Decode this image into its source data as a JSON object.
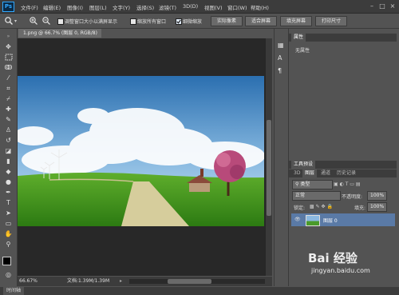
{
  "app": {
    "logo": "Ps"
  },
  "menu": [
    "文件(F)",
    "编辑(E)",
    "图像(I)",
    "图层(L)",
    "文字(Y)",
    "选择(S)",
    "滤镜(T)",
    "3D(D)",
    "视图(V)",
    "窗口(W)",
    "帮助(H)"
  ],
  "window_controls": {
    "minimize": "–",
    "maximize": "□",
    "close": "×"
  },
  "options": {
    "resize_windows_label": "调整窗口大小以满屏显示",
    "resize_windows_checked": false,
    "zoom_all_label": "缩放所有窗口",
    "zoom_all_checked": false,
    "scrubby_label": "细微缩放",
    "scrubby_checked": true,
    "actual_pixels": "实际像素",
    "fit_screen": "适合屏幕",
    "fill_screen": "填充屏幕",
    "print_size": "打印尺寸"
  },
  "document": {
    "tab_title": "1.png @ 66.7% (图层 0, RGB/8)",
    "tab_close": "×"
  },
  "statusbar": {
    "zoom": "66.67%",
    "doc_info": "文档:1.39M/1.39M"
  },
  "bottom": {
    "tab": "时间轴"
  },
  "properties": {
    "title": "属性",
    "content": "无属性"
  },
  "tool_presets": {
    "title": "工具预设"
  },
  "layers": {
    "tabs": [
      "3D",
      "图层",
      "通道",
      "历史记录"
    ],
    "active_tab": "图层",
    "kind_filter": "类型",
    "blend_mode": "正常",
    "opacity_label": "不透明度:",
    "opacity_value": "100%",
    "lock_label": "锁定:",
    "fill_label": "填充:",
    "fill_value": "100%",
    "layer_list": [
      {
        "name": "图层 0",
        "visible": true
      }
    ]
  },
  "watermark": {
    "text": "Bai 经验",
    "url": "jingyan.baidu.com"
  },
  "colors": {
    "menubar": "#3c3c3c",
    "panel": "#535353",
    "canvas_bg": "#282828",
    "accent": "#31a8ff"
  }
}
